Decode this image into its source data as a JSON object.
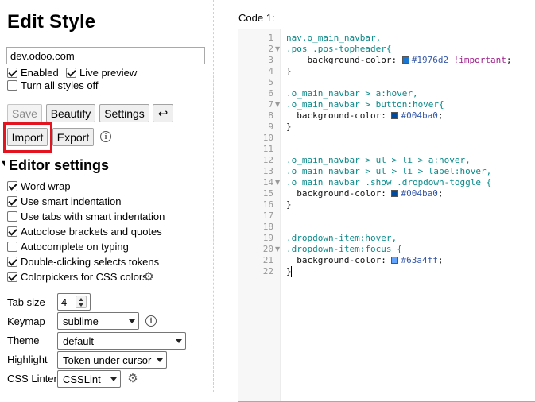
{
  "sidebar": {
    "title": "Edit Style",
    "style_name": "dev.odoo.com",
    "enabled_label": "Enabled",
    "live_preview_label": "Live preview",
    "turn_all_off_label": "Turn all styles off",
    "buttons": {
      "save": "Save",
      "beautify": "Beautify",
      "settings": "Settings",
      "undo": "↩",
      "import": "Import",
      "export": "Export"
    },
    "section_title": "Editor settings",
    "options": [
      {
        "label": "Word wrap",
        "checked": true
      },
      {
        "label": "Use smart indentation",
        "checked": true
      },
      {
        "label": "Use tabs with smart indentation",
        "checked": false
      },
      {
        "label": "Autoclose brackets and quotes",
        "checked": true
      },
      {
        "label": "Autocomplete on typing",
        "checked": false
      },
      {
        "label": "Double-clicking selects tokens",
        "checked": true
      },
      {
        "label": "Colorpickers for CSS colors",
        "checked": true
      }
    ],
    "fields": {
      "tab_size_label": "Tab size",
      "tab_size_value": "4",
      "keymap_label": "Keymap",
      "keymap_value": "sublime",
      "theme_label": "Theme",
      "theme_value": "default",
      "highlight_label": "Highlight",
      "highlight_value": "Token under cursor",
      "css_linter_label": "CSS Linter",
      "css_linter_value": "CSSLint"
    }
  },
  "editor": {
    "label": "Code 1:",
    "line_numbers": [
      "1",
      "2",
      "3",
      "4",
      "5",
      "6",
      "7",
      "8",
      "9",
      "10",
      "11",
      "12",
      "13",
      "14",
      "15",
      "16",
      "17",
      "18",
      "19",
      "20",
      "21",
      "22"
    ],
    "lines": {
      "l1": "nav.o_main_navbar,",
      "l2": ".pos .pos-topheader{",
      "l3_prop": "    background-color: ",
      "l3_val": "#1976d2",
      "l3_imp": " !important",
      "l3_end": ";",
      "l4": "}",
      "l6": ".o_main_navbar > a:hover,",
      "l7": ".o_main_navbar > button:hover{",
      "l8_prop": "  background-color: ",
      "l8_val": "#004ba0",
      "l8_end": ";",
      "l9": "}",
      "l12": ".o_main_navbar > ul > li > a:hover,",
      "l13": ".o_main_navbar > ul > li > label:hover,",
      "l14": ".o_main_navbar .show .dropdown-toggle {",
      "l15_prop": "  background-color: ",
      "l15_val": "#004ba0",
      "l15_end": ";",
      "l16": "}",
      "l19": ".dropdown-item:hover,",
      "l20": ".dropdown-item:focus {",
      "l21_prop": "  background-color: ",
      "l21_val": "#63a4ff",
      "l21_end": ";",
      "l22": "}"
    }
  },
  "colors": {
    "highlight_border": "#e3131f",
    "editor_border": "#6fc2c2",
    "swatch_1": "#1976d2",
    "swatch_2": "#004ba0",
    "swatch_3": "#63a4ff"
  }
}
